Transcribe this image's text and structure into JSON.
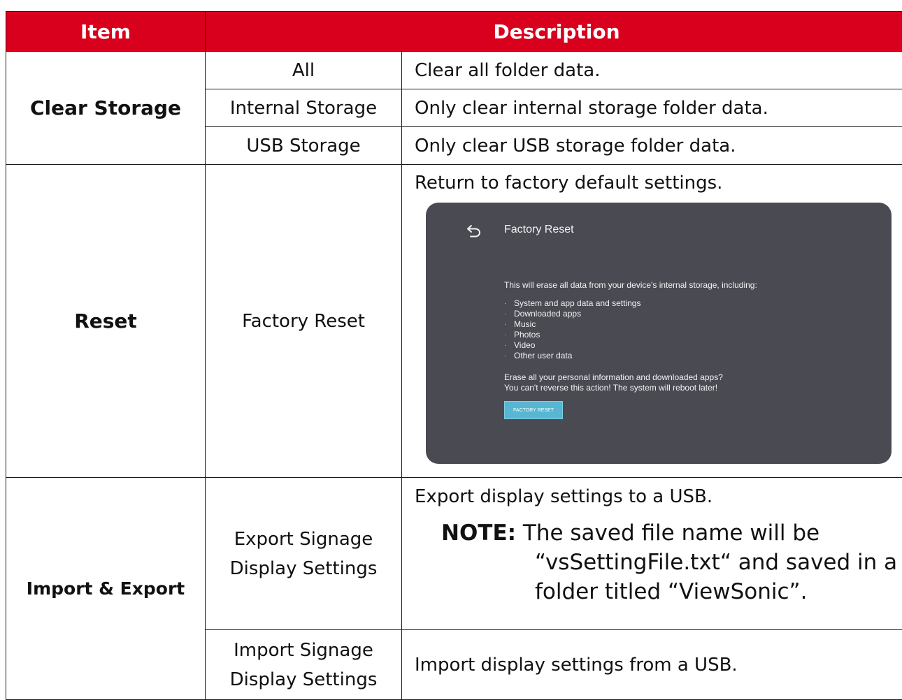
{
  "header": {
    "item": "Item",
    "description": "Description"
  },
  "clear_storage": {
    "label": "Clear Storage",
    "rows": [
      {
        "sub": "All",
        "desc": "Clear all folder data."
      },
      {
        "sub": "Internal Storage",
        "desc": "Only clear internal storage folder data."
      },
      {
        "sub": "USB Storage",
        "desc": "Only clear USB storage folder data."
      }
    ]
  },
  "reset": {
    "label": "Reset",
    "sub": "Factory Reset",
    "desc": "Return to factory default settings.",
    "screenshot": {
      "title": "Factory Reset",
      "message": "This will erase all data from your device's internal storage, including:",
      "items": [
        "System and app data and settings",
        "Downloaded apps",
        "Music",
        "Photos",
        "Video",
        "Other user data"
      ],
      "question": "Erase all your personal information and downloaded apps?",
      "warning": "You can't reverse this action! The system will reboot later!",
      "button": "FACTORY RESET",
      "bg_color": "#4a4a53",
      "button_color": "#57b6d1"
    }
  },
  "import_export": {
    "label": "Import & Export",
    "export_sub_1": "Export Signage",
    "export_sub_2": "Display Settings",
    "export_desc": "Export display settings to a USB.",
    "note_label": "NOTE:",
    "note_line1": "The saved file name will be",
    "note_line2": "“vsSettingFile.txt“ and saved in a",
    "note_line3": "folder titled “ViewSonic”.",
    "import_sub_1": "Import Signage",
    "import_sub_2": "Display Settings",
    "import_desc": "Import display settings from a USB."
  },
  "colors": {
    "header_red": "#d8001c"
  }
}
